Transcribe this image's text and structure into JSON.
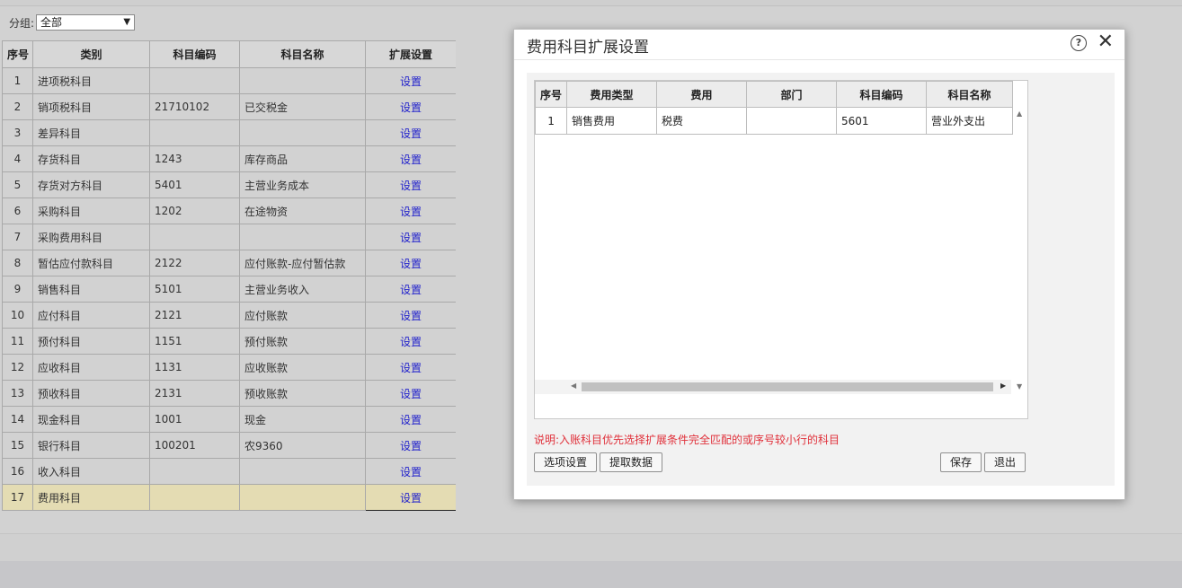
{
  "filter": {
    "label": "分组:",
    "value": "全部"
  },
  "main_table": {
    "headers": [
      "序号",
      "类别",
      "科目编码",
      "科目名称",
      "扩展设置"
    ],
    "rows": [
      {
        "seq": "1",
        "category": "进项税科目",
        "code": "",
        "name": "",
        "action": "设置"
      },
      {
        "seq": "2",
        "category": "销项税科目",
        "code": "21710102",
        "name": "已交税金",
        "action": "设置"
      },
      {
        "seq": "3",
        "category": "差异科目",
        "code": "",
        "name": "",
        "action": "设置"
      },
      {
        "seq": "4",
        "category": "存货科目",
        "code": "1243",
        "name": "库存商品",
        "action": "设置"
      },
      {
        "seq": "5",
        "category": "存货对方科目",
        "code": "5401",
        "name": "主营业务成本",
        "action": "设置"
      },
      {
        "seq": "6",
        "category": "采购科目",
        "code": "1202",
        "name": "在途物资",
        "action": "设置"
      },
      {
        "seq": "7",
        "category": "采购费用科目",
        "code": "",
        "name": "",
        "action": "设置"
      },
      {
        "seq": "8",
        "category": "暂估应付款科目",
        "code": "2122",
        "name": "应付账款-应付暂估款",
        "action": "设置"
      },
      {
        "seq": "9",
        "category": "销售科目",
        "code": "5101",
        "name": "主营业务收入",
        "action": "设置"
      },
      {
        "seq": "10",
        "category": "应付科目",
        "code": "2121",
        "name": "应付账款",
        "action": "设置"
      },
      {
        "seq": "11",
        "category": "预付科目",
        "code": "1151",
        "name": "预付账款",
        "action": "设置"
      },
      {
        "seq": "12",
        "category": "应收科目",
        "code": "1131",
        "name": "应收账款",
        "action": "设置"
      },
      {
        "seq": "13",
        "category": "预收科目",
        "code": "2131",
        "name": "预收账款",
        "action": "设置"
      },
      {
        "seq": "14",
        "category": "现金科目",
        "code": "1001",
        "name": "现金",
        "action": "设置"
      },
      {
        "seq": "15",
        "category": "银行科目",
        "code": "100201",
        "name": "农9360",
        "action": "设置"
      },
      {
        "seq": "16",
        "category": "收入科目",
        "code": "",
        "name": "",
        "action": "设置"
      },
      {
        "seq": "17",
        "category": "费用科目",
        "code": "",
        "name": "",
        "action": "设置"
      }
    ],
    "selected_index": 16
  },
  "dialog": {
    "title": "费用科目扩展设置",
    "headers": [
      "序号",
      "费用类型",
      "费用",
      "部门",
      "科目编码",
      "科目名称"
    ],
    "rows": [
      {
        "seq": "1",
        "type": "销售费用",
        "fee": "税费",
        "dept": "",
        "code": "5601",
        "name": "营业外支出"
      }
    ],
    "note": "说明:入账科目优先选择扩展条件完全匹配的或序号较小行的科目",
    "buttons": {
      "options": "选项设置",
      "fetch": "提取数据",
      "save": "保存",
      "exit": "退出"
    }
  }
}
